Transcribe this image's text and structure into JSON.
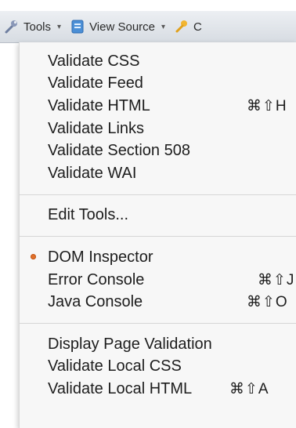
{
  "toolbar": {
    "tools_label": "Tools",
    "view_source_label": "View Source",
    "next_label": "C"
  },
  "menu": {
    "group1": [
      {
        "label": "Validate CSS",
        "shortcut": ""
      },
      {
        "label": "Validate Feed",
        "shortcut": ""
      },
      {
        "label": "Validate HTML",
        "shortcut": "⌘⇧H"
      },
      {
        "label": "Validate Links",
        "shortcut": ""
      },
      {
        "label": "Validate Section 508",
        "shortcut": ""
      },
      {
        "label": "Validate WAI",
        "shortcut": ""
      }
    ],
    "group2": [
      {
        "label": "Edit Tools...",
        "shortcut": ""
      }
    ],
    "group3": [
      {
        "label": "DOM Inspector",
        "shortcut": "",
        "checked": true
      },
      {
        "label": "Error Console",
        "shortcut": "⌘⇧J"
      },
      {
        "label": "Java Console",
        "shortcut": "⌘⇧O"
      }
    ],
    "group4": [
      {
        "label": "Display Page Validation",
        "shortcut": ""
      },
      {
        "label": "Validate Local CSS",
        "shortcut": ""
      },
      {
        "label": "Validate Local HTML",
        "shortcut": "⌘⇧A"
      }
    ]
  },
  "colors": {
    "check_bullet": "#e0702a",
    "menu_bg": "#f7f7f7"
  },
  "icons": {
    "tools": "wrench-icon",
    "view_source": "document-icon",
    "next": "key-icon"
  }
}
